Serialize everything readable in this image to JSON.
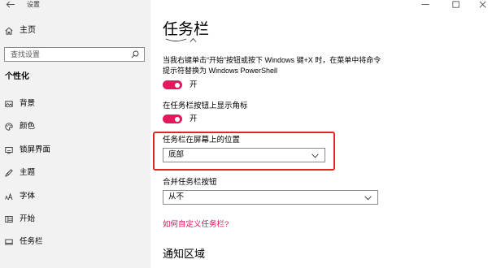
{
  "window": {
    "title": "设置",
    "controls": [
      "minimize-icon",
      "maximize-icon",
      "close-icon"
    ]
  },
  "sidebar": {
    "back_icon": "back-arrow-icon",
    "home": {
      "label": "主页",
      "icon": "home-icon"
    },
    "search": {
      "placeholder": "查找设置",
      "icon": "search-icon"
    },
    "section_title": "个性化",
    "items": [
      {
        "label": "背景",
        "icon": "picture-icon"
      },
      {
        "label": "颜色",
        "icon": "palette-icon"
      },
      {
        "label": "锁屏界面",
        "icon": "lock-screen-icon"
      },
      {
        "label": "主题",
        "icon": "theme-icon"
      },
      {
        "label": "字体",
        "icon": "font-icon"
      },
      {
        "label": "开始",
        "icon": "start-icon"
      },
      {
        "label": "任务栏",
        "icon": "taskbar-icon"
      }
    ]
  },
  "main": {
    "page_title": "任务栏",
    "powershell": {
      "description": "当我右键单击“开始”按钮或按下 Windows 键+X 时，在菜单中将命令提示符替换为 Windows PowerShell",
      "state_label": "开",
      "on": true
    },
    "badges": {
      "label": "在任务栏按钮上显示角标",
      "state_label": "开",
      "on": true
    },
    "position": {
      "label": "任务栏在屏幕上的位置",
      "value": "底部"
    },
    "combine": {
      "label": "合并任务栏按钮",
      "value": "从不"
    },
    "help_link": "如何自定义任务栏?",
    "section_heading": "通知区域"
  },
  "colors": {
    "accent": "#e3195b",
    "link": "#d0195b",
    "highlight_box": "#e32424",
    "sidebar_bg": "#f2f2f2"
  }
}
